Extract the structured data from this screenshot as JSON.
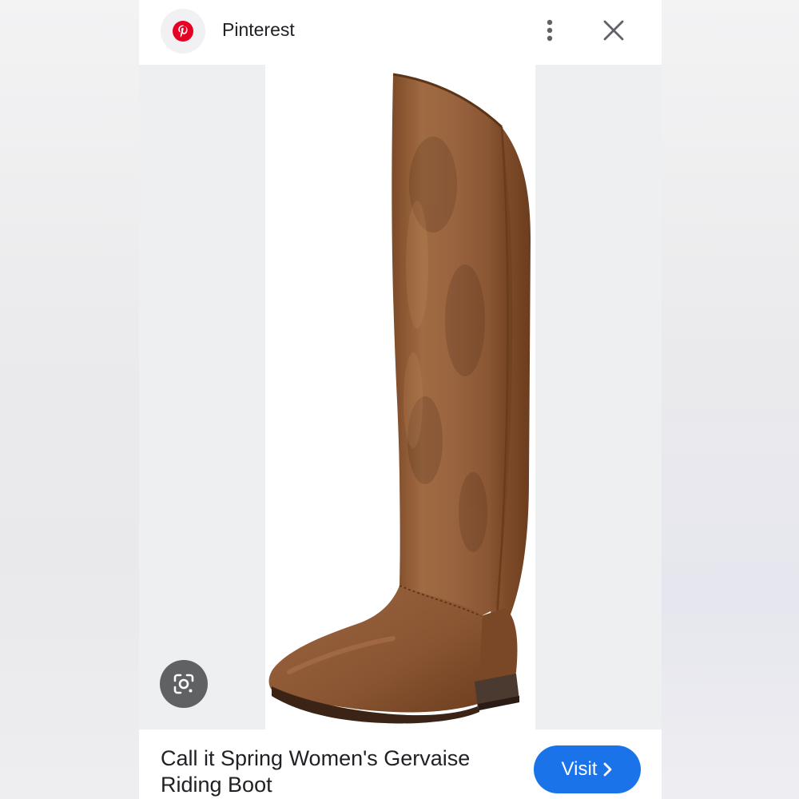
{
  "header": {
    "site_name": "Pinterest",
    "favicon_icon": "pinterest-logo-icon",
    "more_icon": "more-vert-icon",
    "close_icon": "close-icon"
  },
  "image": {
    "subject": "brown-riding-boot-photo",
    "lens_icon": "google-lens-icon"
  },
  "footer": {
    "title_line1": "Call it Spring Women's Gervaise",
    "title_line2": "Riding Boot",
    "visit_label": "Visit",
    "visit_icon": "chevron-right-icon"
  },
  "colors": {
    "pinterest_red": "#e60023",
    "visit_blue": "#1a73e8",
    "boot_brown": "#96603a"
  }
}
